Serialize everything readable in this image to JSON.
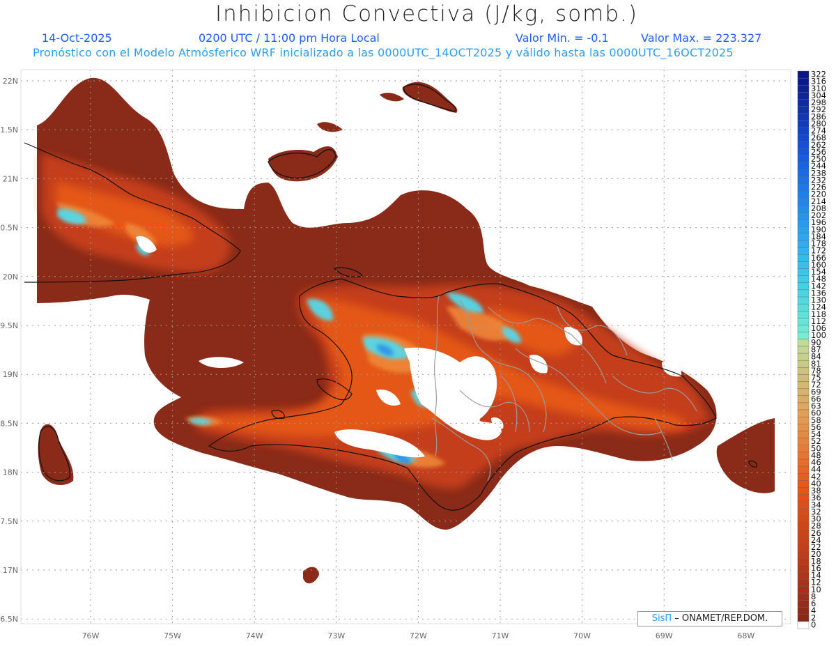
{
  "header": {
    "title": "Inhibicion Convectiva (J/kg, somb.)",
    "date": "14-Oct-2025",
    "time": "0200 UTC / 11:00 pm Hora Local",
    "valor_min": "Valor Min. = -0.1",
    "valor_max": "Valor Max. = 223.327",
    "subtitle": "Pronóstico con el Modelo Atmósferico WRF inicializado a las 0000UTC_14OCT2025 y válido hasta las  0000UTC_16OCT2025"
  },
  "map": {
    "lat_labels": [
      "22N",
      "1.5N",
      "21N",
      "0.5N",
      "20N",
      "9.5N",
      "19N",
      "8.5N",
      "18N",
      "7.5N",
      "17N",
      "6.5N"
    ],
    "lon_labels": [
      "76W",
      "75W",
      "74W",
      "73W",
      "72W",
      "71W",
      "70W",
      "69W",
      "68W"
    ],
    "grid": true,
    "colors": {
      "base": "#8a2a18",
      "mid": "#c8401a",
      "warm": "#e85a18",
      "light": "#f08a3a",
      "cyan": "#55d8e8",
      "blue": "#2a8ce8",
      "no_data": "#ffffff"
    }
  },
  "logo": {
    "brand": "SisΠ",
    "text": "– ONAMET/REP.DOM."
  },
  "colorbar": {
    "labels": [
      "322",
      "316",
      "310",
      "304",
      "298",
      "292",
      "286",
      "280",
      "274",
      "268",
      "262",
      "256",
      "250",
      "244",
      "238",
      "232",
      "226",
      "220",
      "214",
      "208",
      "202",
      "196",
      "190",
      "184",
      "178",
      "172",
      "166",
      "160",
      "154",
      "148",
      "142",
      "136",
      "130",
      "124",
      "118",
      "112",
      "106",
      "100",
      "90",
      "87",
      "84",
      "81",
      "78",
      "75",
      "72",
      "69",
      "66",
      "63",
      "60",
      "58",
      "56",
      "54",
      "52",
      "50",
      "48",
      "46",
      "44",
      "42",
      "40",
      "38",
      "36",
      "34",
      "32",
      "30",
      "28",
      "26",
      "24",
      "22",
      "20",
      "18",
      "16",
      "14",
      "12",
      "10",
      "8",
      "6",
      "4",
      "2",
      "0"
    ]
  }
}
